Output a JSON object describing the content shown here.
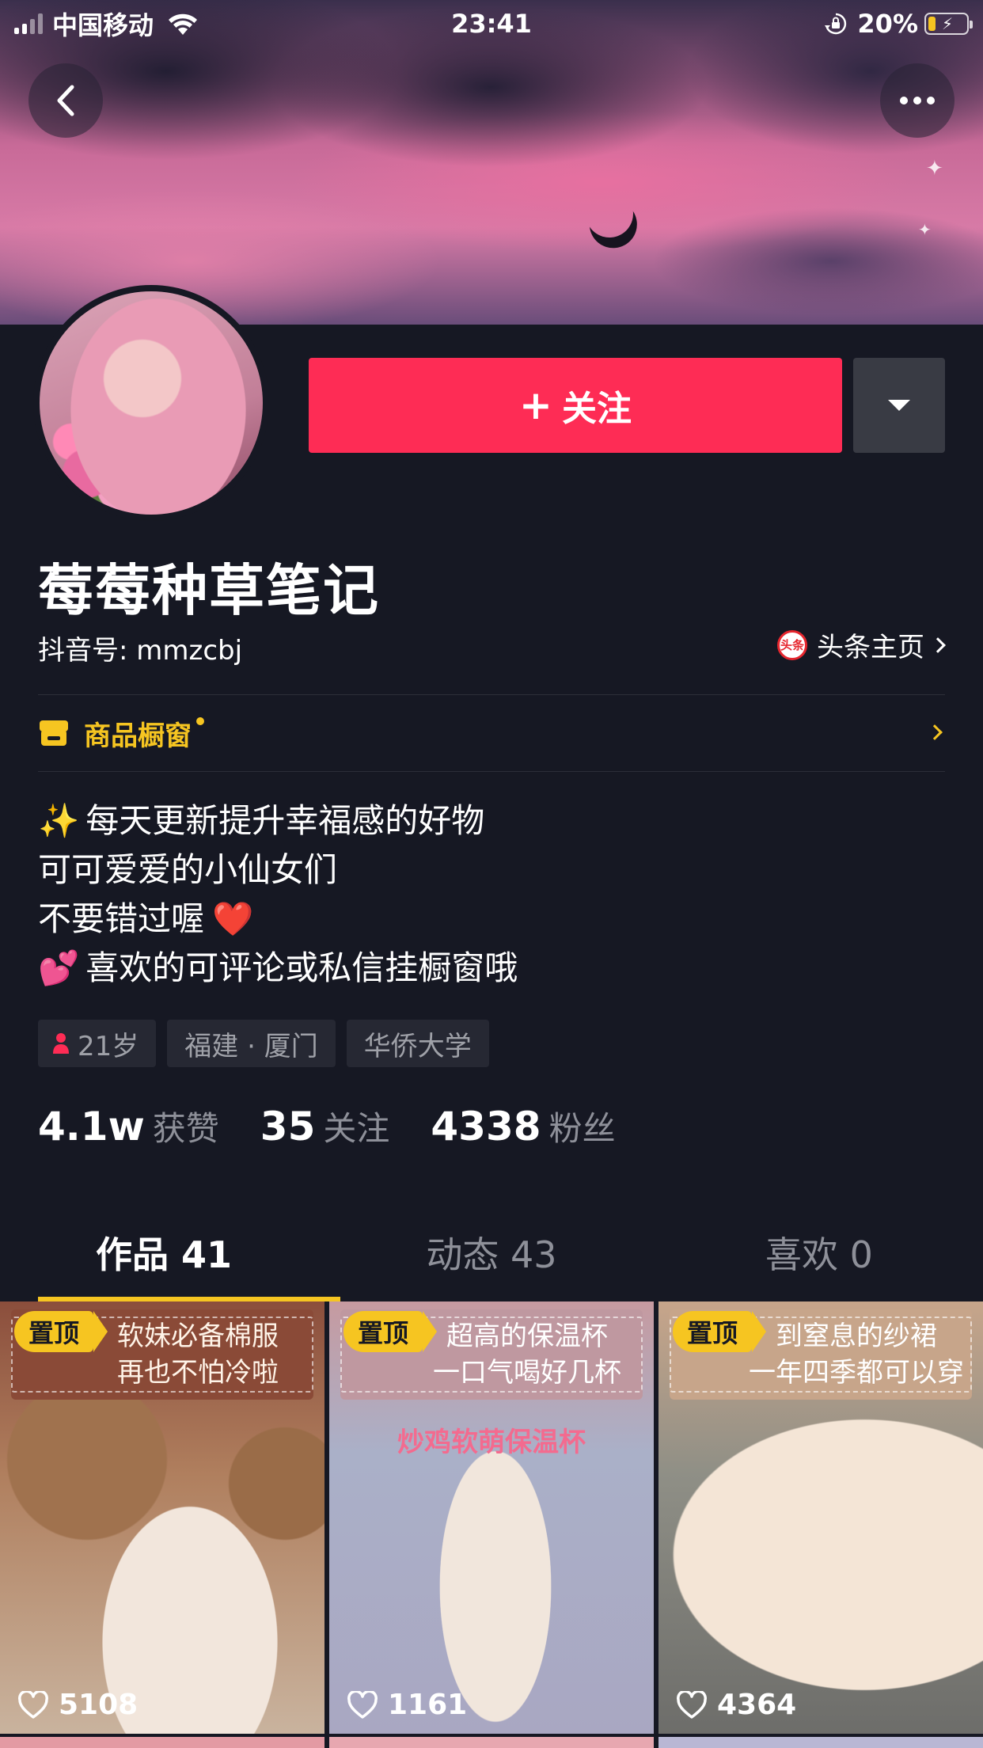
{
  "status_bar": {
    "carrier": "中国移动",
    "time": "23:41",
    "battery_percent": "20%",
    "battery_level": 0.2,
    "icons": [
      "signal-icon",
      "wifi-icon",
      "rotation-lock-icon",
      "battery-icon"
    ]
  },
  "header": {
    "back_icon": "chevron-left-icon",
    "more_icon": "more-dots-icon"
  },
  "profile": {
    "name": "莓莓种草笔记",
    "douyin_id": "抖音号: mmzcbj",
    "toutiao_badge": "头条",
    "toutiao_link": "头条主页",
    "follow_button": "关注",
    "follow_prefix": "+",
    "shop_label": "商品橱窗",
    "bio_lines": [
      {
        "emoji": "✨",
        "text": "每天更新提升幸福感的好物"
      },
      {
        "emoji": "",
        "text": "可可爱爱的小仙女们"
      },
      {
        "emoji": "",
        "text": "不要错过喔",
        "suffix": "❤️"
      },
      {
        "emoji": "💕",
        "text": "喜欢的可评论或私信挂橱窗哦"
      }
    ],
    "tags": {
      "age": "21岁",
      "location": "福建 · 厦门",
      "school": "华侨大学"
    },
    "stats": [
      {
        "num": "4.1w",
        "label": "获赞"
      },
      {
        "num": "35",
        "label": "关注"
      },
      {
        "num": "4338",
        "label": "粉丝"
      }
    ]
  },
  "tabs": [
    {
      "label": "作品 41",
      "active": true
    },
    {
      "label": "动态 43",
      "active": false
    },
    {
      "label": "喜欢 0",
      "active": false
    }
  ],
  "videos": [
    {
      "pin": "置顶",
      "line1": "软妹必备棉服",
      "line2": "再也不怕冷啦",
      "likes": "5108",
      "subtitle": ""
    },
    {
      "pin": "置顶",
      "line1": "超高的保温杯",
      "line2": "一口气喝好几杯",
      "likes": "1161",
      "subtitle": "炒鸡软萌保温杯"
    },
    {
      "pin": "置顶",
      "line1": "到窒息的纱裙",
      "line2": "一年四季都可以穿",
      "likes": "4364",
      "subtitle": ""
    }
  ],
  "colors": {
    "background": "#161823",
    "accent_red": "#fe2c55",
    "accent_yellow": "#f6c521",
    "muted_text": "#8e9099"
  }
}
